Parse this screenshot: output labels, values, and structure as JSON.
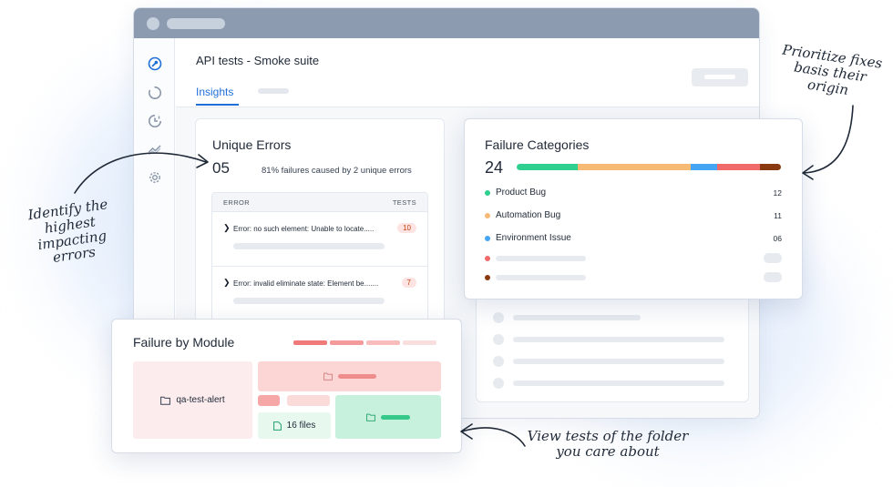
{
  "window": {
    "page_title": "API tests - Smoke suite",
    "active_tab": "Insights",
    "sidebar_icons": [
      "wrench-icon",
      "circle-progress-icon",
      "pie-chart-icon",
      "trend-chart-icon",
      "gear-icon"
    ]
  },
  "unique_errors": {
    "title": "Unique Errors",
    "count": "05",
    "summary": "81% failures caused by 2 unique errors",
    "columns": {
      "error": "ERROR",
      "tests": "TESTS"
    },
    "rows": [
      {
        "error": "Error: no such element: Unable to locate.....",
        "tests": "10"
      },
      {
        "error": "Error: invalid eliminate state: Element be.......",
        "tests": "7"
      }
    ]
  },
  "failure_categories": {
    "title": "Failure Categories",
    "total": "24",
    "items": [
      {
        "label": "Product Bug",
        "count": "12",
        "color": "#2fcf8f"
      },
      {
        "label": "Automation Bug",
        "count": "11",
        "color": "#f6ba75"
      },
      {
        "label": "Environment Issue",
        "count": "06",
        "color": "#45a5f5"
      }
    ],
    "placeholder_colors": [
      "#f06a6a",
      "#8a3a10"
    ],
    "bar_segments": [
      {
        "color": "#2fcf8f",
        "share": 0.23
      },
      {
        "color": "#f6ba75",
        "share": 0.43
      },
      {
        "color": "#45a5f5",
        "share": 0.1
      },
      {
        "color": "#f06a6a",
        "share": 0.16
      },
      {
        "color": "#8a3a10",
        "share": 0.08
      }
    ]
  },
  "failure_by_module": {
    "title": "Failure by Module",
    "legend_colors": [
      "#f07a7a",
      "#f59a9a",
      "#f8bcbc",
      "#f9dede"
    ],
    "folder_label": "qa-test-alert",
    "files_label": "16 files"
  },
  "annotations": {
    "left": "Identify the highest impacting errors",
    "right": "Prioritize fixes basis their origin",
    "bottom": "View tests of the folder you care about"
  }
}
